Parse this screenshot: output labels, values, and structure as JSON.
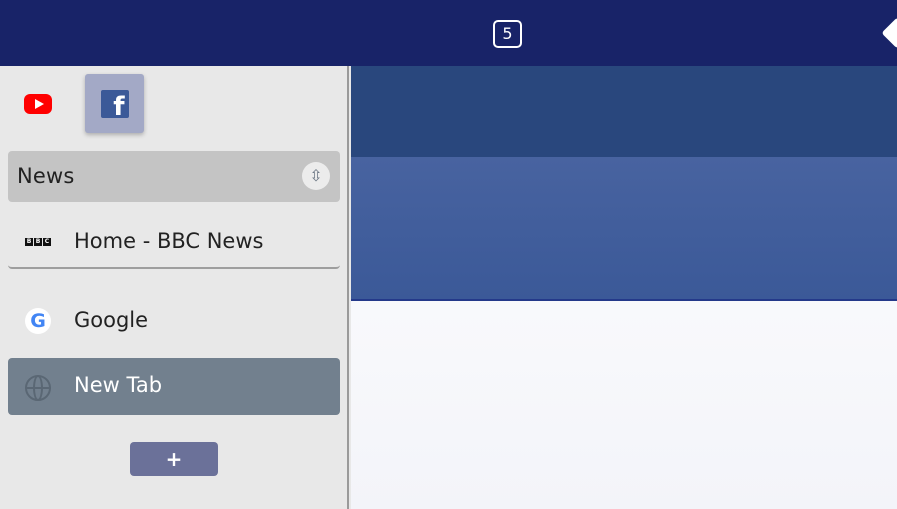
{
  "topbar": {
    "tab_count": "5",
    "colors": {
      "background": "#182368"
    }
  },
  "sidebar": {
    "pinned": [
      {
        "name": "YouTube",
        "icon": "youtube-icon"
      },
      {
        "name": "Facebook",
        "icon": "facebook-icon",
        "active": true
      }
    ],
    "group": {
      "title": "News",
      "toggle_icon": "up-down-arrows-icon"
    },
    "tabs": [
      {
        "label": "Home - BBC News",
        "icon": "bbc-icon"
      },
      {
        "label": "Google",
        "icon": "google-icon"
      },
      {
        "label": "New Tab",
        "icon": "globe-icon",
        "selected": true
      }
    ],
    "add_button": "+"
  },
  "content": {
    "colors": {
      "band_dark": "#29477d",
      "band_light": "#3b5998"
    }
  }
}
